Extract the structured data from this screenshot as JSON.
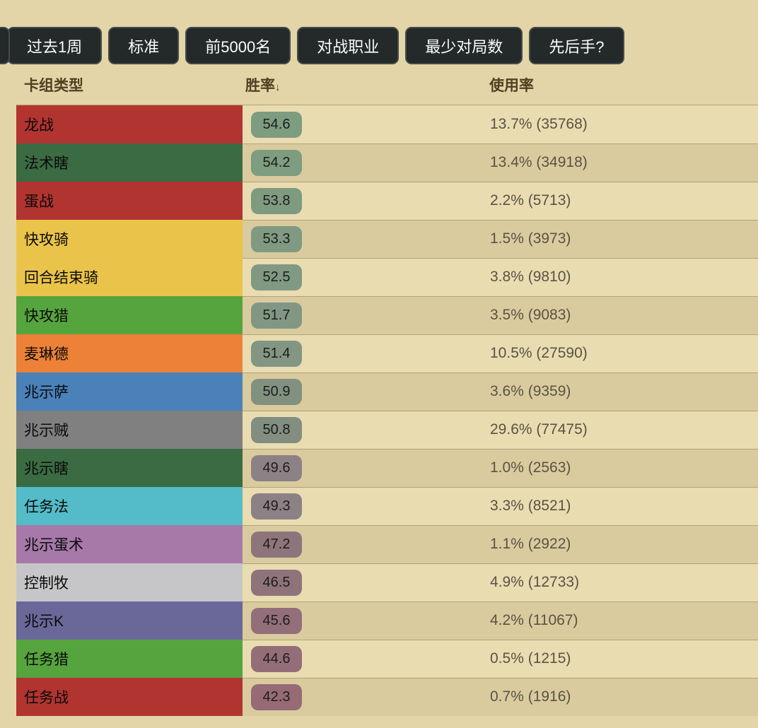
{
  "filters": {
    "buttons": [
      {
        "label": "过去1周"
      },
      {
        "label": "标准"
      },
      {
        "label": "前5000名"
      },
      {
        "label": "对战职业"
      },
      {
        "label": "最少对局数"
      },
      {
        "label": "先后手?"
      }
    ]
  },
  "table": {
    "columns": [
      {
        "label": "卡组类型"
      },
      {
        "label": "胜率",
        "sort_indicator": "↓"
      },
      {
        "label": "使用率"
      }
    ],
    "rows": [
      {
        "deck": "龙战",
        "class_color": "#b23431",
        "winrate": "54.6",
        "winrate_color": "#7d9c80",
        "usage": "13.7% (35768)"
      },
      {
        "deck": "法术瞎",
        "class_color": "#3a6b42",
        "winrate": "54.2",
        "winrate_color": "#7d9c80",
        "usage": "13.4% (34918)"
      },
      {
        "deck": "蛋战",
        "class_color": "#b23431",
        "winrate": "53.8",
        "winrate_color": "#7e9b80",
        "usage": "2.2% (5713)"
      },
      {
        "deck": "快攻骑",
        "class_color": "#eac44a",
        "winrate": "53.3",
        "winrate_color": "#7f9a81",
        "usage": "1.5% (3973)"
      },
      {
        "deck": "回合结束骑",
        "class_color": "#eac44a",
        "winrate": "52.5",
        "winrate_color": "#809982",
        "usage": "3.8% (9810)"
      },
      {
        "deck": "快攻猎",
        "class_color": "#56a43e",
        "winrate": "51.7",
        "winrate_color": "#819784",
        "usage": "3.5% (9083)"
      },
      {
        "deck": "麦琳德",
        "class_color": "#ec8137",
        "winrate": "51.4",
        "winrate_color": "#829683",
        "usage": "10.5% (27590)"
      },
      {
        "deck": "兆示萨",
        "class_color": "#4a81b9",
        "winrate": "50.9",
        "winrate_color": "#81907f",
        "usage": "3.6% (9359)"
      },
      {
        "deck": "兆示贼",
        "class_color": "#808080",
        "winrate": "50.8",
        "winrate_color": "#818e80",
        "usage": "29.6% (77475)"
      },
      {
        "deck": "兆示瞎",
        "class_color": "#3a6b42",
        "winrate": "49.6",
        "winrate_color": "#8c8286",
        "usage": "1.0% (2563)"
      },
      {
        "deck": "任务法",
        "class_color": "#54bcc8",
        "winrate": "49.3",
        "winrate_color": "#8c8185",
        "usage": "3.3% (8521)"
      },
      {
        "deck": "兆示蛋术",
        "class_color": "#a679a9",
        "winrate": "47.2",
        "winrate_color": "#8e757c",
        "usage": "1.1% (2922)"
      },
      {
        "deck": "控制牧",
        "class_color": "#c6c6c8",
        "winrate": "46.5",
        "winrate_color": "#8f737b",
        "usage": "4.9% (12733)"
      },
      {
        "deck": "兆示K",
        "class_color": "#6a6899",
        "winrate": "45.6",
        "winrate_color": "#926f7a",
        "usage": "4.2% (11067)"
      },
      {
        "deck": "任务猎",
        "class_color": "#56a43e",
        "winrate": "44.6",
        "winrate_color": "#936e79",
        "usage": "0.5% (1215)"
      },
      {
        "deck": "任务战",
        "class_color": "#b23431",
        "winrate": "42.3",
        "winrate_color": "#966b76",
        "usage": "0.7% (1916)"
      }
    ]
  },
  "theme": {
    "page_bg": "#e3d5a7",
    "row_light": "#e9dcb1",
    "row_dark": "#d9cb9e",
    "separator": "#b3a277",
    "button_bg": "#242929",
    "button_border": "#434b4b",
    "button_text": "#fcfcfc",
    "header_text": "#504023",
    "usage_text": "#5a5244",
    "deck_text": "#0a0a0a",
    "badge_text": "#1d1d1d"
  }
}
